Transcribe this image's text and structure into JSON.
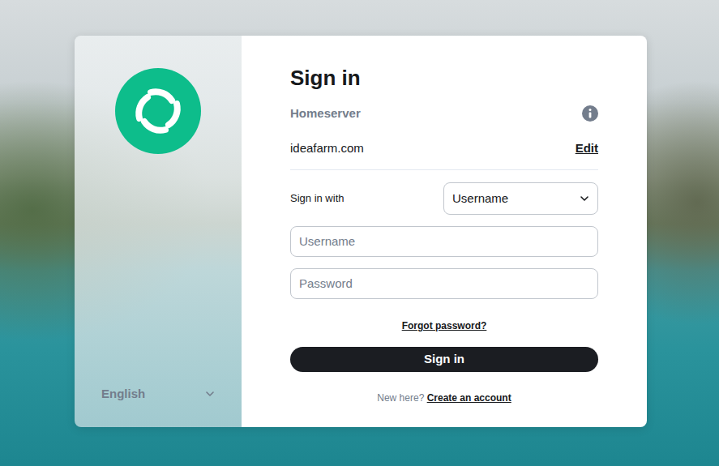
{
  "language": {
    "label": "English"
  },
  "heading": "Sign in",
  "homeserver": {
    "label": "Homeserver",
    "value": "ideafarm.com",
    "edit": "Edit"
  },
  "sign_in_with": {
    "label": "Sign in with",
    "value": "Username"
  },
  "fields": [
    {
      "placeholder": "Username",
      "kind": "text"
    },
    {
      "placeholder": "Password",
      "kind": "password"
    }
  ],
  "forgot": "Forgot password?",
  "submit": "Sign in",
  "footer": {
    "prompt": "New here?",
    "link": "Create an account"
  }
}
